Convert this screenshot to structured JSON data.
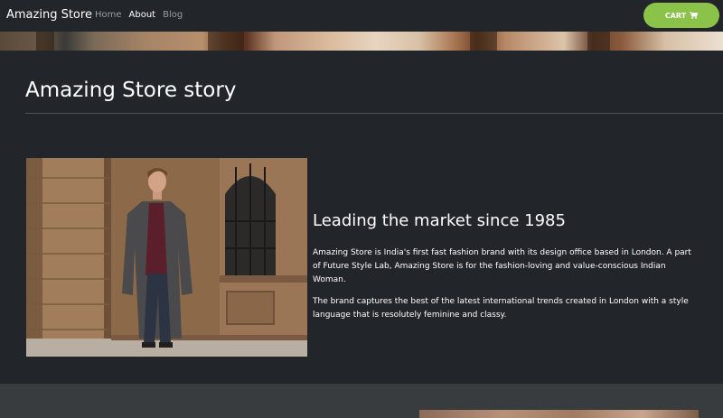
{
  "navbar": {
    "brand": "Amazing Store",
    "links": [
      {
        "label": "Home",
        "active": false
      },
      {
        "label": "About",
        "active": true
      },
      {
        "label": "Blog",
        "active": false
      }
    ],
    "cart_label": "CART",
    "cart_icon": "cart-icon",
    "accent_color": "#8bc34a"
  },
  "story": {
    "title": "Amazing Store story"
  },
  "feature": {
    "heading": "Leading the market since 1985",
    "paragraphs": [
      "Amazing Store is India's first fast fashion brand with its design office based in London. A part of Future Style Lab, Amazing Store is for the fashion-loving and value-conscious Indian Woman.",
      "The brand captures the best of the latest international trends created in London with a style language that is resolutely feminine and classy."
    ]
  },
  "colors": {
    "background": "#22252a",
    "lower_section": "#393c3f",
    "divider": "#52565b"
  }
}
